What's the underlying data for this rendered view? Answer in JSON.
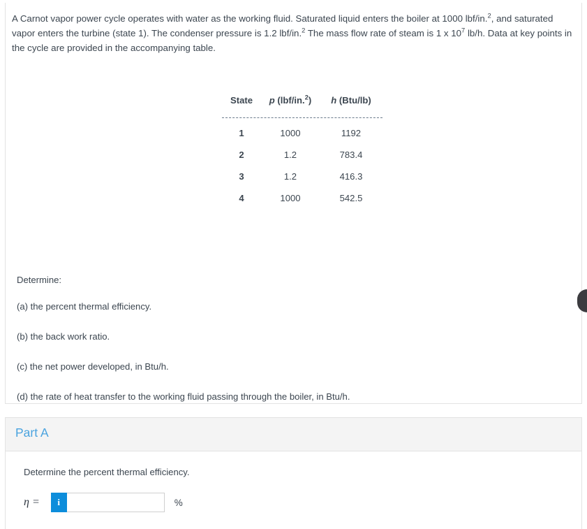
{
  "question": {
    "stem_parts": [
      {
        "t": "A Carnot vapor power cycle operates with water as the working fluid. Saturated liquid enters the boiler at 1000 lbf/in."
      },
      {
        "sup": "2"
      },
      {
        "t": ", and saturated vapor enters the turbine (state 1). The condenser pressure is 1.2 lbf/in."
      },
      {
        "sup": "2"
      },
      {
        "t": " The mass flow rate of steam is 1 x 10"
      },
      {
        "sup": "7"
      },
      {
        "t": " lb/h. Data at key points in the cycle are provided in the accompanying table."
      }
    ],
    "stem_text": "A Carnot vapor power cycle operates with water as the working fluid. Saturated liquid enters the boiler at 1000 lbf/in.2, and saturated vapor enters the turbine (state 1). The condenser pressure is 1.2 lbf/in.2 The mass flow rate of steam is 1 x 107 lb/h. Data at key points in the cycle are provided in the accompanying table."
  },
  "table": {
    "headers": {
      "state": "State",
      "p_symbol": "p",
      "p_units": " (lbf/in.",
      "p_sup": "2",
      "p_close": ")",
      "h_symbol": "h",
      "h_units": " (Btu/lb)"
    },
    "rows": [
      {
        "state": "1",
        "p": "1000",
        "h": "1192"
      },
      {
        "state": "2",
        "p": "1.2",
        "h": "783.4"
      },
      {
        "state": "3",
        "p": "1.2",
        "h": "416.3"
      },
      {
        "state": "4",
        "p": "1000",
        "h": "542.5"
      }
    ]
  },
  "determine": {
    "lead": "Determine:",
    "items": [
      "(a) the percent thermal efficiency.",
      "(b) the back work ratio.",
      "(c) the net power developed, in Btu/h.",
      "(d) the rate of heat transfer to the working fluid passing through the boiler, in Btu/h."
    ]
  },
  "part_a": {
    "title": "Part A",
    "prompt": "Determine the percent thermal efficiency.",
    "answer_label": "η =",
    "info_icon": "i",
    "input_value": "",
    "input_placeholder": "",
    "unit": "%"
  },
  "colors": {
    "accent_blue": "#0d8ddb",
    "title_blue": "#4aa3df",
    "text": "#3c4650",
    "card_border": "#e3e3e3",
    "header_bg": "#f4f4f4",
    "handle": "#3b3b3f"
  }
}
